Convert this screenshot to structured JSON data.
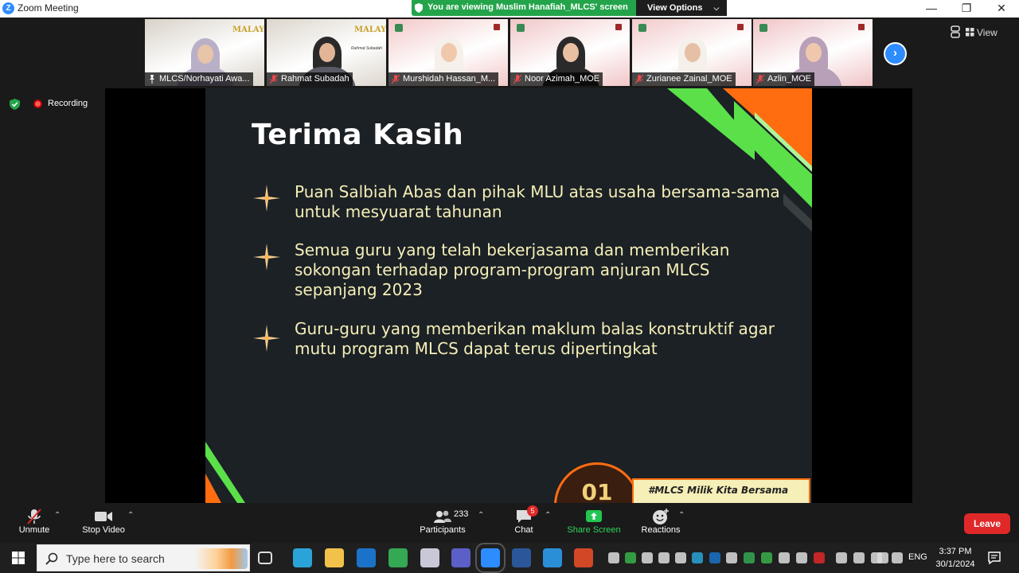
{
  "window": {
    "title": "Zoom Meeting",
    "logo_letter": "Z"
  },
  "banner": {
    "message": "You are viewing Muslim Hanafiah_MLCS' screen",
    "view_options": "View Options"
  },
  "top_right": {
    "view_label": "View"
  },
  "participants_strip": [
    {
      "name": "MLCS/Norhayati Awa...",
      "muted": false,
      "active": true,
      "bg": "#d8d2c8"
    },
    {
      "name": "Rahmat Subadah",
      "muted": true,
      "active": false,
      "bg": "#dcd6cc"
    },
    {
      "name": "Murshidah Hassan_M...",
      "muted": true,
      "active": false,
      "bg": "#f3c8c8"
    },
    {
      "name": "Noor Azimah_MOE",
      "muted": true,
      "active": false,
      "bg": "#f1c6c6"
    },
    {
      "name": "Zurianee Zainal_MOE",
      "muted": true,
      "active": false,
      "bg": "#f2c9c9"
    },
    {
      "name": "Azlin_MOE",
      "muted": true,
      "active": false,
      "bg": "#f0c4c6"
    }
  ],
  "recording": {
    "label": "Recording"
  },
  "slide": {
    "title": "Terima Kasih",
    "bullets": [
      "Puan Salbiah Abas dan pihak MLU atas usaha bersama-sama untuk mesyuarat tahunan",
      "Semua guru yang telah bekerjasama dan memberikan sokongan terhadap program-program anjuran MLCS sepanjang 2023",
      "Guru-guru yang memberikan maklum balas konstruktif agar mutu program MLCS dapat terus dipertingkat"
    ],
    "badge_number": "01",
    "footer_tag": "#MLCS Milik Kita Bersama",
    "thumb_logo_text": "MALAY",
    "thumb_name_tag": "Rahmat Subadah",
    "colors": {
      "accent_green": "#5be04a",
      "accent_orange": "#ff6d10",
      "text_cream": "#f6efb8",
      "background": "#1b2125"
    }
  },
  "toolbar": {
    "unmute": "Unmute",
    "stop_video": "Stop Video",
    "participants_count": "233",
    "participants": "Participants",
    "chat_badge": "5",
    "chat": "Chat",
    "share_screen": "Share Screen",
    "reactions": "Reactions",
    "leave": "Leave"
  },
  "taskbar": {
    "search_placeholder": "Type here to search",
    "lang": "ENG",
    "time": "3:37 PM",
    "date": "30/1/2024"
  }
}
